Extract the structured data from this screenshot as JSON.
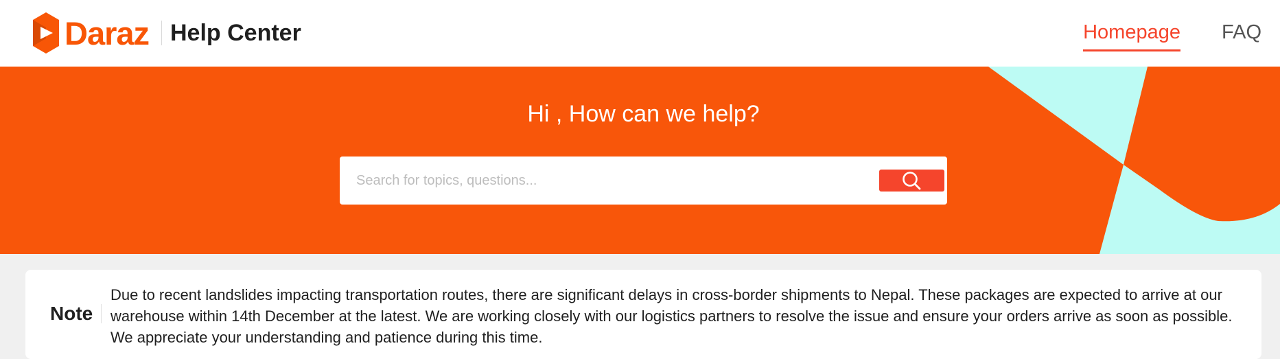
{
  "header": {
    "logo": {
      "text": "Daraz",
      "icon": "daraz-logo-icon",
      "color": "#f85606"
    },
    "title": "Help Center",
    "nav": [
      {
        "label": "Homepage",
        "active": true
      },
      {
        "label": "FAQ",
        "active": false
      }
    ],
    "accent_color": "#f5452c"
  },
  "hero": {
    "heading": "Hi , How can we help?",
    "background_color": "#f8560a",
    "decor_color": "#bdfbf4",
    "search": {
      "placeholder": "Search for topics, questions...",
      "value": "",
      "button_icon": "search-icon"
    }
  },
  "note": {
    "label": "Note",
    "text": "Due to recent landslides impacting transportation routes, there are significant delays in cross-border shipments to Nepal. These packages are expected to arrive at our warehouse within 14th December at the latest. We are working closely with our logistics partners to resolve the issue and ensure your orders arrive as soon as possible. We appreciate your understanding and patience during this time."
  }
}
